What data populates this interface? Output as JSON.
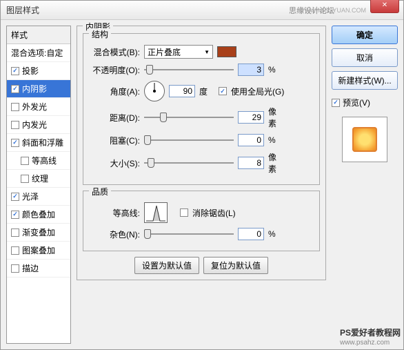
{
  "title": "图层样式",
  "titlebar_right": "思缘设计论坛",
  "titlebar_url": "WWW.MISSYUAN.COM",
  "left": {
    "header": "样式",
    "blend_options": "混合选项:自定",
    "items": [
      {
        "label": "投影",
        "checked": true
      },
      {
        "label": "内阴影",
        "checked": true,
        "selected": true
      },
      {
        "label": "外发光",
        "checked": false
      },
      {
        "label": "内发光",
        "checked": false
      },
      {
        "label": "斜面和浮雕",
        "checked": true
      },
      {
        "label": "等高线",
        "checked": false,
        "sub": true
      },
      {
        "label": "纹理",
        "checked": false,
        "sub": true
      },
      {
        "label": "光泽",
        "checked": true
      },
      {
        "label": "颜色叠加",
        "checked": true
      },
      {
        "label": "渐变叠加",
        "checked": false
      },
      {
        "label": "图案叠加",
        "checked": false
      },
      {
        "label": "描边",
        "checked": false
      }
    ]
  },
  "mid": {
    "main_title": "内阴影",
    "structure_title": "结构",
    "blend_mode_label": "混合模式(B):",
    "blend_mode_value": "正片叠底",
    "swatch_color": "#a8401a",
    "opacity_label": "不透明度(O):",
    "opacity_value": "3",
    "opacity_unit": "%",
    "angle_label": "角度(A):",
    "angle_value": "90",
    "angle_unit": "度",
    "global_light": "使用全局光(G)",
    "global_light_checked": true,
    "distance_label": "距离(D):",
    "distance_value": "29",
    "distance_unit": "像素",
    "choke_label": "阻塞(C):",
    "choke_value": "0",
    "choke_unit": "%",
    "size_label": "大小(S):",
    "size_value": "8",
    "size_unit": "像素",
    "quality_title": "品质",
    "contour_label": "等高线:",
    "antialias": "消除锯齿(L)",
    "antialias_checked": false,
    "noise_label": "杂色(N):",
    "noise_value": "0",
    "noise_unit": "%",
    "set_default": "设置为默认值",
    "reset_default": "复位为默认值"
  },
  "right": {
    "ok": "确定",
    "cancel": "取消",
    "new_style": "新建样式(W)...",
    "preview": "预览(V)",
    "preview_checked": true
  },
  "watermark": "PS爱好者教程网",
  "watermark_url": "www.psahz.com"
}
